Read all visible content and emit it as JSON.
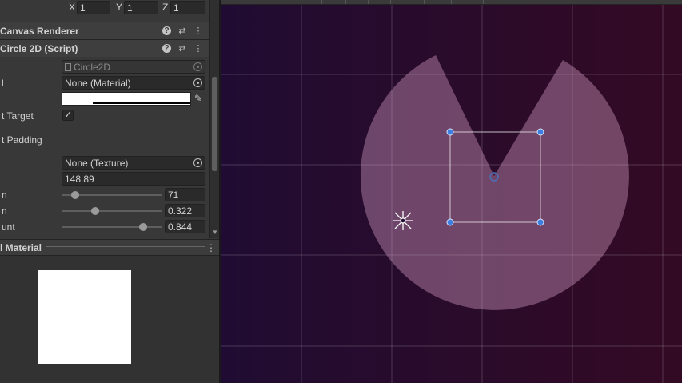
{
  "inspector": {
    "position": {
      "x_label": "X",
      "x_value": "1",
      "y_label": "Y",
      "y_value": "1",
      "z_label": "Z",
      "z_value": "1"
    },
    "canvas_renderer": {
      "title": "Canvas Renderer"
    },
    "circle_component": {
      "title": "Circle 2D (Script)",
      "script_value": "Circle2D",
      "material_label": "l",
      "material_value": "None (Material)",
      "raycast_label": "t Target",
      "raycast_checked": "✓",
      "padding_label": "t Padding",
      "texture_value": "None (Texture)",
      "radius_value": "148.89",
      "slider1_label": "n",
      "slider1_value": "71",
      "slider1_fraction": 0.1,
      "slider2_label": "n",
      "slider2_value": "0.322",
      "slider2_fraction": 0.322,
      "slider3_label": "unt",
      "slider3_value": "0.844",
      "slider3_fraction": 0.844
    },
    "material_section": {
      "title": "l Material"
    }
  },
  "icons": {
    "help": "?",
    "presets": "⇄",
    "menu": "⋮",
    "eyedropper": "✎",
    "scroll_down": "▼"
  },
  "scene": {
    "background_left": "#200c32",
    "background_right": "#330a24",
    "circle_fill": "#d9a0c8",
    "circle_opacity": 0.4,
    "handle_color": "#3d7fe0"
  }
}
